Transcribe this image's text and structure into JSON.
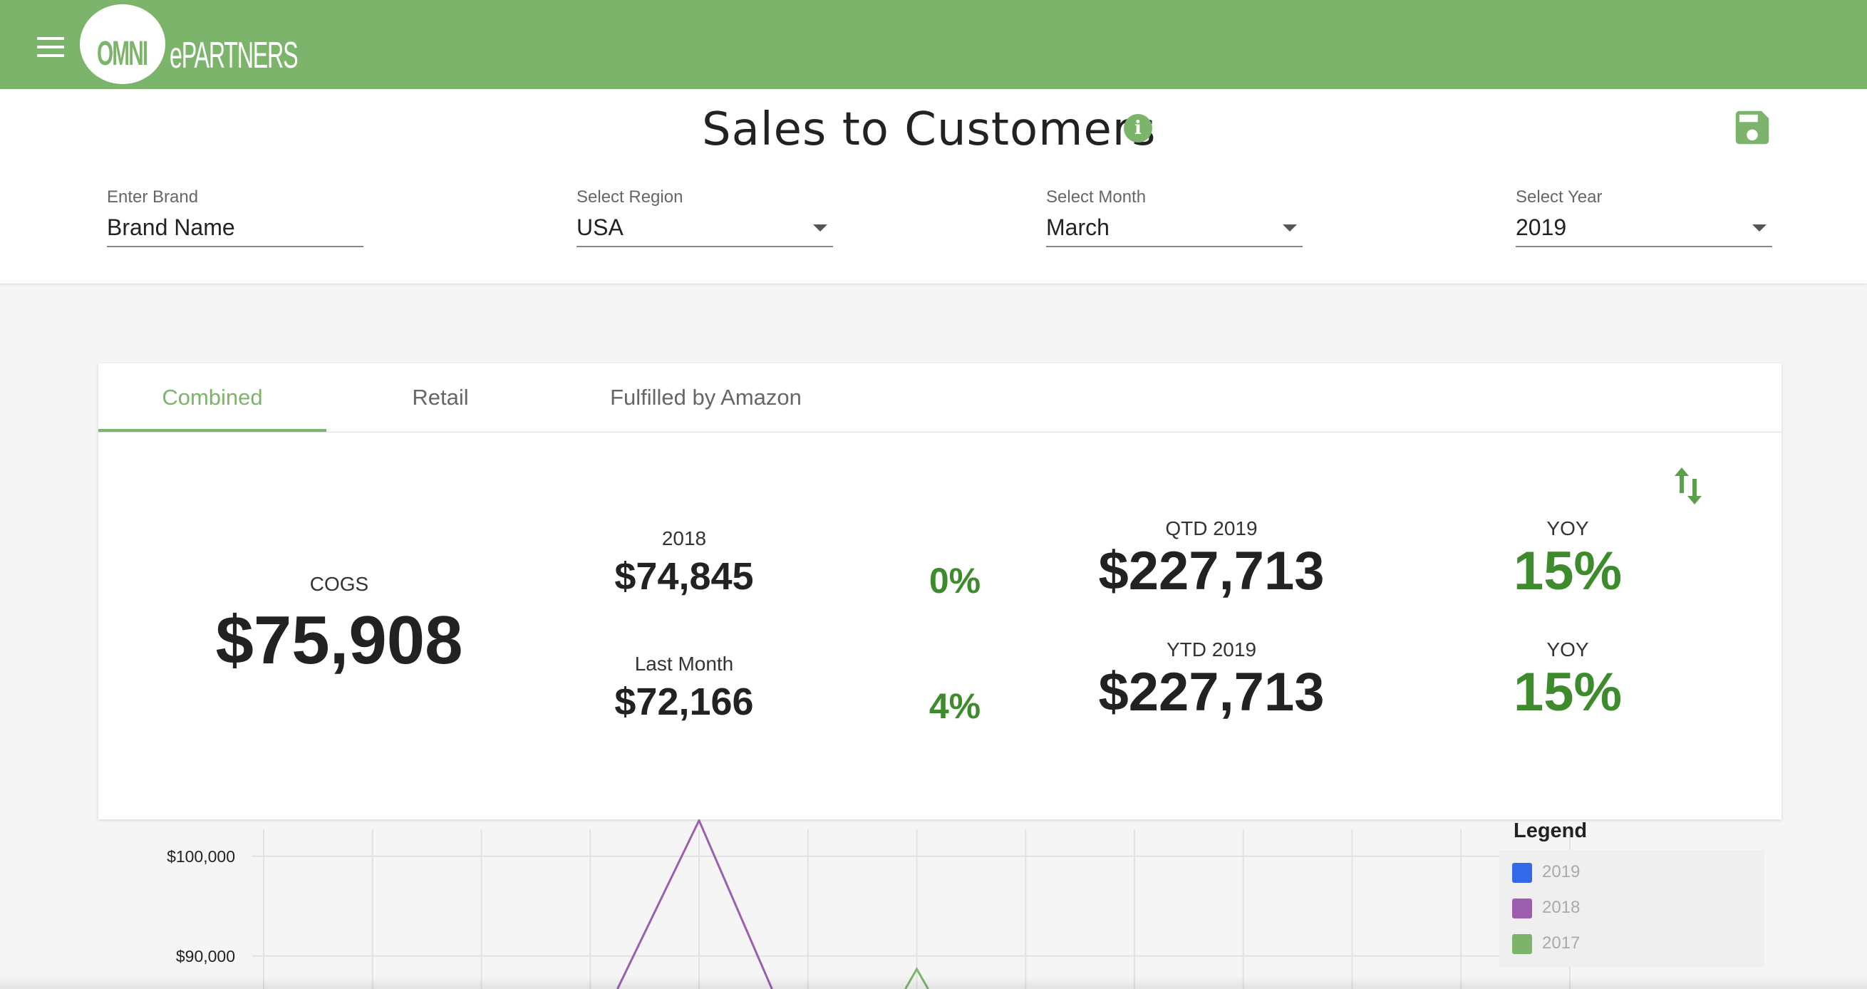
{
  "app": {
    "logo_omni": "OMNI",
    "logo_partners": "ePARTNERS"
  },
  "page": {
    "title": "Sales to Customers"
  },
  "filters": {
    "brand": {
      "label": "Enter Brand",
      "value": "Brand Name"
    },
    "region": {
      "label": "Select Region",
      "value": "USA"
    },
    "month": {
      "label": "Select Month",
      "value": "March"
    },
    "year": {
      "label": "Select Year",
      "value": "2019"
    }
  },
  "tabs": [
    {
      "label": "Combined",
      "active": true
    },
    {
      "label": "Retail",
      "active": false
    },
    {
      "label": "Fulfilled by Amazon",
      "active": false
    }
  ],
  "metrics": {
    "cogs": {
      "label": "COGS",
      "value": "$75,908"
    },
    "prev_year": {
      "label": "2018",
      "value": "$74,845",
      "pct": "0%"
    },
    "last_month": {
      "label": "Last Month",
      "value": "$72,166",
      "pct": "4%"
    },
    "qtd": {
      "label": "QTD 2019",
      "value": "$227,713"
    },
    "qtd_yoy": {
      "label": "YOY",
      "value": "15%"
    },
    "ytd": {
      "label": "YTD 2019",
      "value": "$227,713"
    },
    "ytd_yoy": {
      "label": "YOY",
      "value": "15%"
    }
  },
  "chart_data": {
    "type": "line",
    "yticks": [
      "$100,000",
      "$90,000"
    ],
    "y_tick_values": [
      100000,
      90000
    ],
    "ylim": [
      86700,
      103700
    ],
    "grid": true,
    "x_slot_count": 12,
    "series": [
      {
        "name": "2018",
        "color": "#9c5fb0",
        "points": [
          [
            3.25,
            86700
          ],
          [
            4,
            103600
          ],
          [
            4.67,
            86700
          ]
        ]
      },
      {
        "name": "2017",
        "color": "#7db46c",
        "points": [
          [
            6,
            88700
          ]
        ]
      }
    ],
    "legend_title": "Legend",
    "legend": [
      {
        "name": "2019",
        "color": "#3369e8"
      },
      {
        "name": "2018",
        "color": "#9c5fb0"
      },
      {
        "name": "2017",
        "color": "#7db46c"
      }
    ]
  },
  "colors": {
    "brand_green": "#7db46c",
    "positive_green": "#3d8b2c"
  },
  "icons": {
    "menu": "hamburger-menu-icon",
    "info": "info-icon",
    "save": "floppy-disk-icon",
    "swap": "swap-vertical-icon"
  }
}
